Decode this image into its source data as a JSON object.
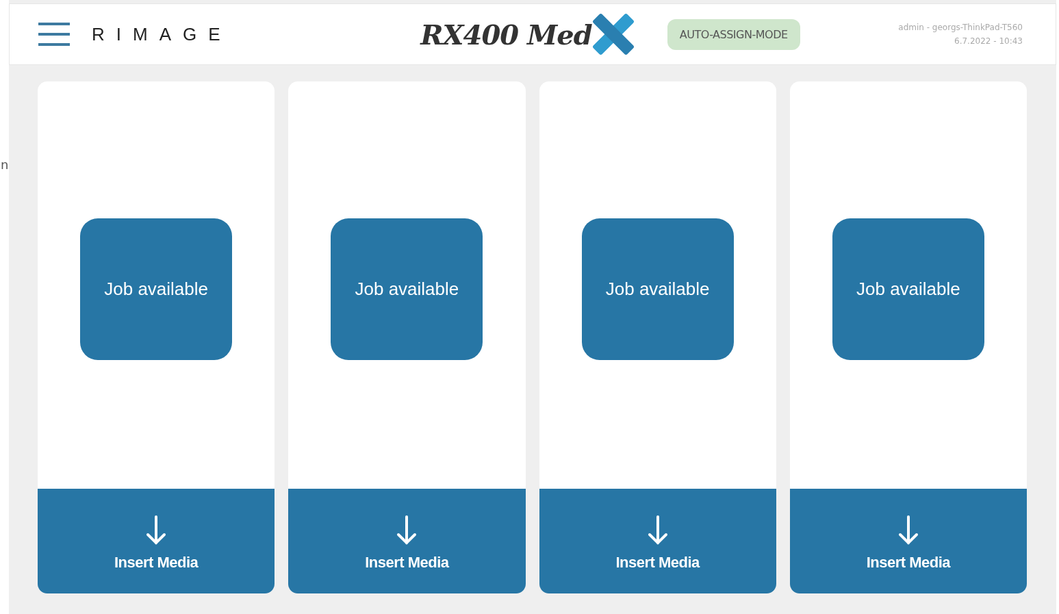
{
  "edge_text": "n",
  "header": {
    "brand": "RIMAGE",
    "product": "RX400 Med",
    "mode_badge": "AUTO-ASSIGN-MODE",
    "user": "admin - georgs-ThinkPad-T560",
    "datetime": "6.7.2022 - 10:43"
  },
  "slots": [
    {
      "status": "Job available",
      "action": "Insert Media"
    },
    {
      "status": "Job available",
      "action": "Insert Media"
    },
    {
      "status": "Job available",
      "action": "Insert Media"
    },
    {
      "status": "Job available",
      "action": "Insert Media"
    }
  ]
}
